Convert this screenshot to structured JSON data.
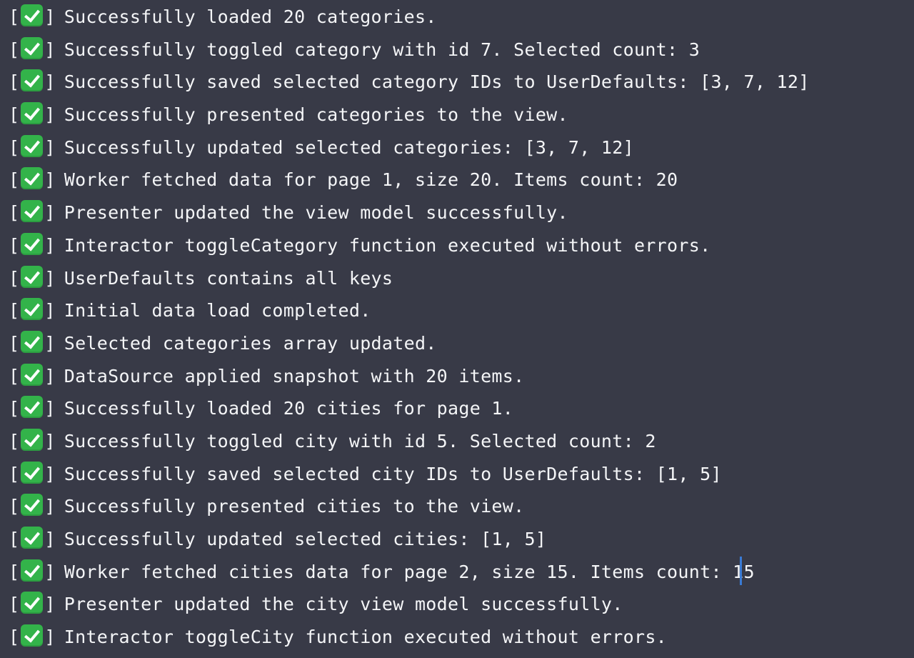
{
  "console": {
    "bracket_open": "[",
    "bracket_close": "]",
    "status_icon": "check-mark-button-icon",
    "check_color": "#33b34a",
    "lines": [
      "Successfully loaded 20 categories.",
      "Successfully toggled category with id 7. Selected count: 3",
      "Successfully saved selected category IDs to UserDefaults: [3, 7, 12]",
      "Successfully presented categories to the view.",
      "Successfully updated selected categories: [3, 7, 12]",
      "Worker fetched data for page 1, size 20. Items count: 20",
      "Presenter updated the view model successfully.",
      "Interactor toggleCategory function executed without errors.",
      "UserDefaults contains all keys",
      "Initial data load completed.",
      "Selected categories array updated.",
      "DataSource applied snapshot with 20 items.",
      "Successfully loaded 20 cities for page 1.",
      "Successfully toggled city with id 5. Selected count: 2",
      "Successfully saved selected city IDs to UserDefaults: [1, 5]",
      "Successfully presented cities to the view.",
      "Successfully updated selected cities: [1, 5]",
      "Worker fetched cities data for page 2, size 15. Items count: 15",
      "Presenter updated the city view model successfully.",
      "Interactor toggleCity function executed without errors."
    ]
  }
}
